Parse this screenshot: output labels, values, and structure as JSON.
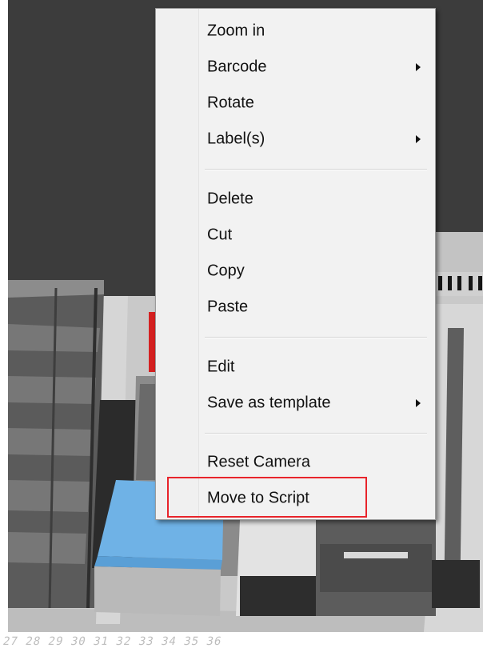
{
  "context_menu": {
    "items": [
      {
        "label": "Zoom in",
        "submenu": false
      },
      {
        "label": "Barcode",
        "submenu": true
      },
      {
        "label": "Rotate",
        "submenu": false
      },
      {
        "label": "Label(s)",
        "submenu": true
      },
      {
        "label": "Delete",
        "submenu": false
      },
      {
        "label": "Cut",
        "submenu": false
      },
      {
        "label": "Copy",
        "submenu": false
      },
      {
        "label": "Paste",
        "submenu": false
      },
      {
        "label": "Edit",
        "submenu": false
      },
      {
        "label": "Save as template",
        "submenu": true
      },
      {
        "label": "Reset Camera",
        "submenu": false
      },
      {
        "label": "Move to Script",
        "submenu": false,
        "highlighted": true
      }
    ],
    "highlight_color": "#e8242b"
  },
  "ruler": {
    "text": "27 28 29 30 31 32 33 34 35 36"
  },
  "colors": {
    "scene_background": "#3c3c3c",
    "selected_item": "#6fb2e6",
    "red_item": "#d42020"
  }
}
